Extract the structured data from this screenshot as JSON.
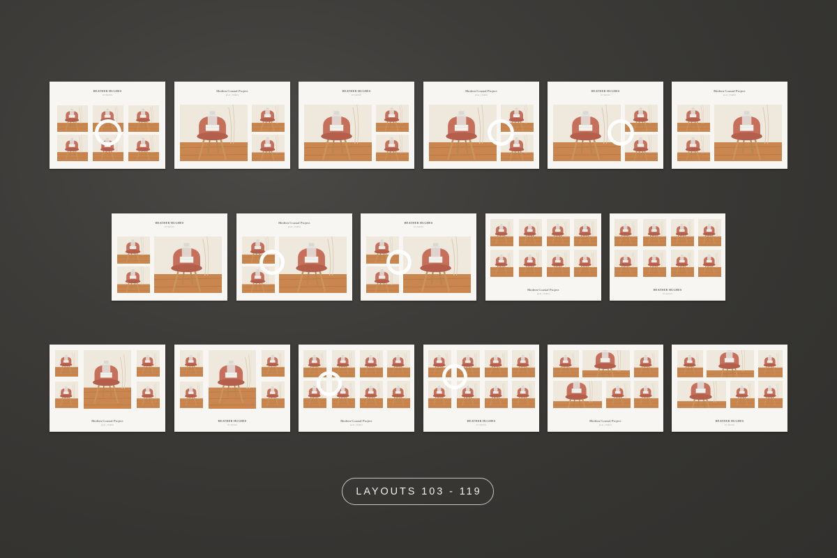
{
  "badge": {
    "label": "LAYOUTS 103 - 119"
  },
  "photo_subject": "pink velvet chair with wooden legs and vase",
  "pages": [
    {
      "id": 103,
      "title": "HEATHER HUGHES",
      "subtitle": "BY HUGHES"
    },
    {
      "id": 104,
      "title": "Modern Coastal Project",
      "subtitle": "@ALL_STORIES"
    },
    {
      "id": 105,
      "title": "HEATHER HUGHES",
      "subtitle": "BY HUGHES"
    },
    {
      "id": 106,
      "title": "Modern Coastal Project",
      "subtitle": "@ALL_STORIES"
    },
    {
      "id": 107,
      "title": "HEATHER HUGHES",
      "subtitle": "BY HUGHES"
    },
    {
      "id": 108,
      "title": "Modern Coastal Project",
      "subtitle": "@ALL_STORIES"
    },
    {
      "id": 109,
      "title": "HEATHER HUGHES",
      "subtitle": "BY HUGHES"
    },
    {
      "id": 110,
      "title": "Modern Coastal Project",
      "subtitle": "@ALL_STORIES"
    },
    {
      "id": 111,
      "title": "HEATHER HUGHES",
      "subtitle": "BY HUGHES"
    },
    {
      "id": 112,
      "title": "Modern Coastal Project",
      "subtitle": "@ALL_STORIES"
    },
    {
      "id": 113,
      "title": "HEATHER HUGHES",
      "subtitle": "BY HUGHES"
    },
    {
      "id": 114,
      "title": "Modern Coastal Project",
      "subtitle": "@ALL_STORIES"
    },
    {
      "id": 115,
      "title": "HEATHER HUGHES",
      "subtitle": "BY HUGHES"
    },
    {
      "id": 116,
      "title": "Modern Coastal Project",
      "subtitle": "@ALL_STORIES"
    },
    {
      "id": 117,
      "title": "HEATHER HUGHES",
      "subtitle": "BY HUGHES"
    },
    {
      "id": 118,
      "title": "Modern Coastal Project",
      "subtitle": "@ALL_STORIES"
    },
    {
      "id": 119,
      "title": "HEATHER HUGHES",
      "subtitle": "BY HUGHES"
    }
  ],
  "colors": {
    "background": "#3a3936",
    "card": "#f7f6f3",
    "chair": "#c66f5a",
    "floor": "#c98a55",
    "badge_text": "#f1efea"
  }
}
